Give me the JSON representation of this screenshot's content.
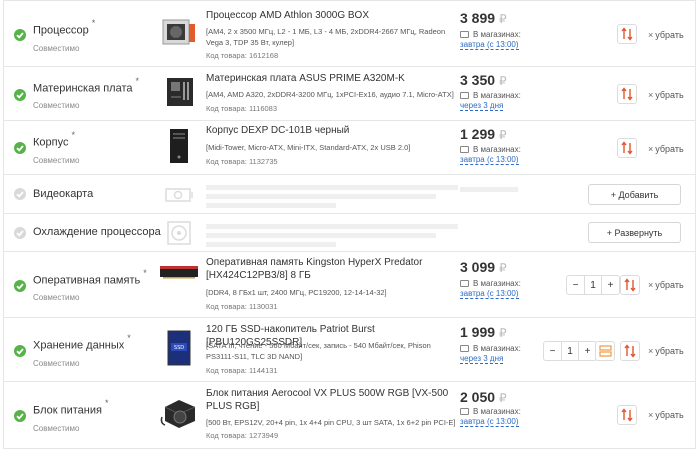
{
  "components": [
    {
      "category": "Процессор",
      "required": "*",
      "compat": "Совместимо",
      "name": "Процессор AMD Athlon 3000G BOX",
      "spec": "[AM4, 2 x 3500 МГц, L2 - 1 МБ, L3 - 4 МБ, 2xDDR4-2667 МГц, Radeon Vega 3, TDP 35 Вт, кулер]",
      "code": "Код товара: 1612168",
      "price": "3 899",
      "currency": "₽",
      "store_label": "В магазинах:",
      "store_when": "завтра (с 13:00)",
      "remove_label": "убрать",
      "thumb_icon": "cpu-box-icon"
    },
    {
      "category": "Материнская плата",
      "required": "*",
      "compat": "Совместимо",
      "name": "Материнская плата ASUS PRIME A320M-K",
      "spec": "[AM4, AMD A320, 2xDDR4-3200 МГц, 1xPCI-Ex16, аудио 7.1, Micro-ATX]",
      "code": "Код товара: 1116083",
      "price": "3 350",
      "currency": "₽",
      "store_label": "В магазинах:",
      "store_when": "через 3 дня",
      "remove_label": "убрать",
      "thumb_icon": "motherboard-icon"
    },
    {
      "category": "Корпус",
      "required": "*",
      "compat": "Совместимо",
      "name": "Корпус DEXP DC-101B черный",
      "spec": "[Midi-Tower, Micro-ATX, Mini-ITX, Standard-ATX, 2x USB 2.0]",
      "code": "Код товара: 1132735",
      "price": "1 299",
      "currency": "₽",
      "store_label": "В магазинах:",
      "store_when": "завтра (с 13:00)",
      "remove_label": "убрать",
      "thumb_icon": "pc-case-icon"
    },
    {
      "category": "Видеокарта",
      "action": "+ Добавить",
      "thumb_icon": "gpu-placeholder-icon"
    },
    {
      "category": "Охлаждение процессора",
      "action": "+ Развернуть",
      "thumb_icon": "cooler-placeholder-icon"
    },
    {
      "category": "Оперативная память",
      "required": "*",
      "compat": "Совместимо",
      "name": "Оперативная память Kingston HyperX Predator [HX424C12PB3/8] 8 ГБ",
      "spec": "[DDR4, 8 ГБх1 шт, 2400 МГц, PC19200, 12-14-14-32]",
      "code": "Код товара: 1130031",
      "price": "3 099",
      "currency": "₽",
      "store_label": "В магазинах:",
      "store_when": "завтра (с 13:00)",
      "remove_label": "убрать",
      "qty": "1",
      "thumb_icon": "ram-module-icon"
    },
    {
      "category": "Хранение данных",
      "required": "*",
      "compat": "Совместимо",
      "name": "120 ГБ SSD-накопитель Patriot Burst [PBU120GS25SSDR]",
      "spec": "[SATA III, чтение - 560 Мбайт/сек, запись - 540 Мбайт/сек, Phison PS3111-S11, TLC 3D NAND]",
      "code": "Код товара: 1144131",
      "price": "1 999",
      "currency": "₽",
      "store_label": "В магазинах:",
      "store_when": "через 3 дня",
      "remove_label": "убрать",
      "qty": "1",
      "thumb_icon": "ssd-icon"
    },
    {
      "category": "Блок питания",
      "required": "*",
      "compat": "Совместимо",
      "name": "Блок питания Aerocool VX PLUS 500W RGB [VX-500 PLUS RGB]",
      "spec": "[500 Вт, EPS12V, 20+4 pin, 1x 4+4 pin CPU, 3 шт SATA, 1x 6+2 pin PCI-E]",
      "code": "Код товара: 1273949",
      "price": "2 050",
      "currency": "₽",
      "store_label": "В магазинах:",
      "store_when": "завтра (с 13:00)",
      "remove_label": "убрать",
      "thumb_icon": "psu-icon"
    }
  ],
  "colors": {
    "ok": "#57b249",
    "link": "#2d6bc4",
    "swap": "#e0552e",
    "storage_accent": "#f0a24a"
  },
  "icons": {
    "swap": "swap-arrows-icon",
    "remove": "close-icon",
    "check": "check-icon",
    "storage_toggle": "storage-toggle-icon"
  }
}
